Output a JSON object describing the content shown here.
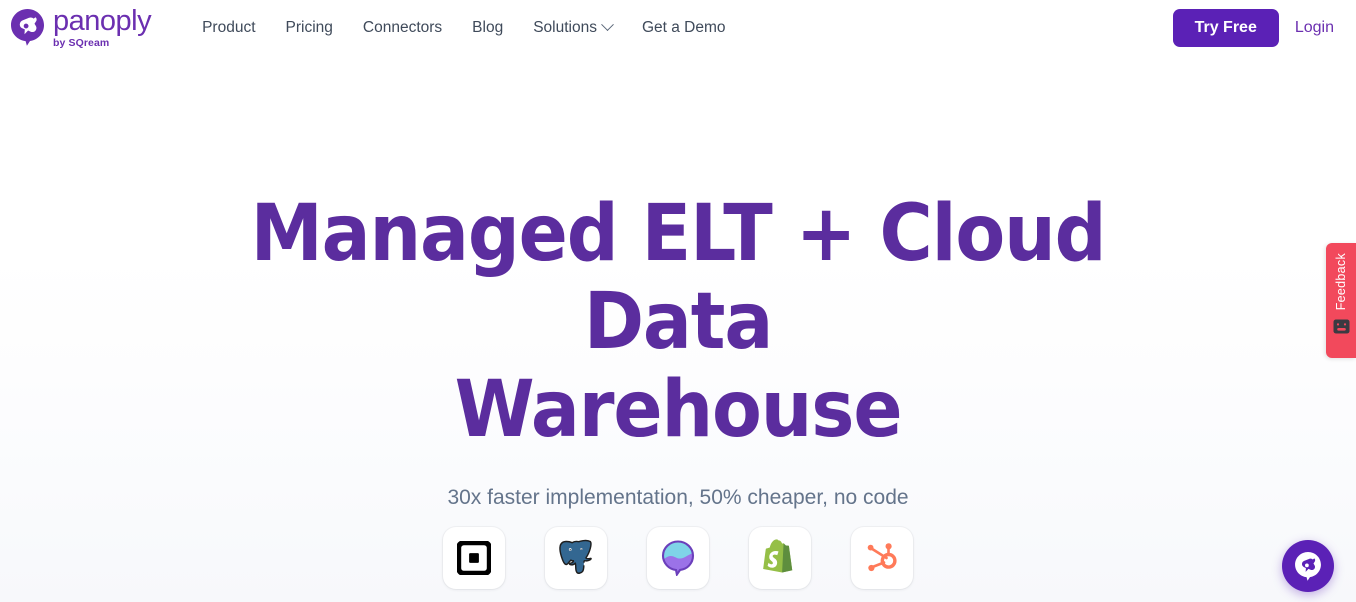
{
  "brand": {
    "name": "panoply",
    "tagline": "by SQream",
    "logo_icon": "panoply-pin-icon",
    "color": "#6b2fb0"
  },
  "nav": {
    "items": [
      {
        "label": "Product",
        "has_dropdown": false
      },
      {
        "label": "Pricing",
        "has_dropdown": false
      },
      {
        "label": "Connectors",
        "has_dropdown": false
      },
      {
        "label": "Blog",
        "has_dropdown": false
      },
      {
        "label": "Solutions",
        "has_dropdown": true
      },
      {
        "label": "Get a Demo",
        "has_dropdown": false
      }
    ]
  },
  "header_actions": {
    "try_free_label": "Try Free",
    "try_free_color": "#5b21b6",
    "login_label": "Login",
    "login_color": "#6b2fb0"
  },
  "hero": {
    "title_line1": "Managed ELT + Cloud Data",
    "title_line2": "Warehouse",
    "title_color": "#5b2d9e",
    "subtitle": "30x faster implementation, 50% cheaper, no code",
    "subtitle_color": "#64748b"
  },
  "connectors": {
    "items": [
      {
        "name": "Square",
        "icon": "square-logo-icon",
        "color": "#000000"
      },
      {
        "name": "PostgreSQL",
        "icon": "postgresql-elephant-icon",
        "color": "#336791"
      },
      {
        "name": "Intercom",
        "icon": "purple-pin-wave-icon",
        "color": "#8b5cd6"
      },
      {
        "name": "Shopify",
        "icon": "shopify-bag-icon",
        "color": "#7ab55c"
      },
      {
        "name": "HubSpot",
        "icon": "hubspot-sprocket-icon",
        "color": "#ff7a59"
      }
    ]
  },
  "feedback_widget": {
    "label": "Feedback",
    "icon": "smiley-face-icon",
    "color": "#f2495c"
  },
  "chat_widget": {
    "icon": "panoply-pin-icon",
    "color": "#5b21b6"
  }
}
